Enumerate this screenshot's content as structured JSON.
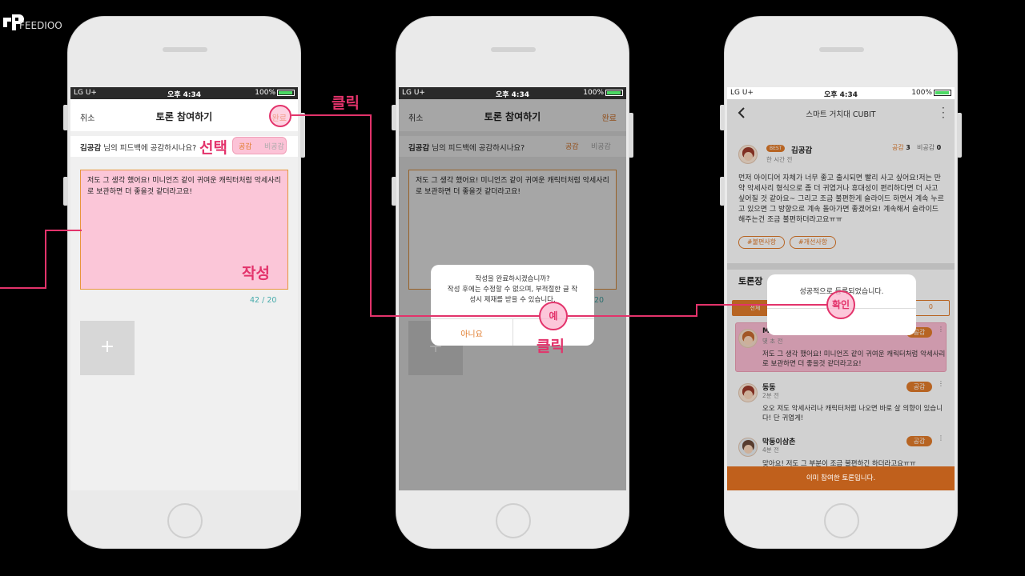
{
  "logo": {
    "text": "FEEDIOO"
  },
  "annotations": {
    "click1": "클릭",
    "select": "선택",
    "write": "작성",
    "click2": "클릭"
  },
  "status": {
    "carrier": "LG U+",
    "time": "오후 4:34",
    "battery": "100%"
  },
  "phone1": {
    "cancel": "취소",
    "title": "토론 참여하기",
    "done": "완료",
    "question_name": "김공감",
    "question_text": " 님의 피드백에 공감하시나요?",
    "agree": "공감",
    "disagree": "비공감",
    "body": "저도 그 생각 했어요! 미니언즈 같이 귀여운 캐릭터처럼 악세사리로 보관하면 더 좋을것 같더라고요!",
    "count": "42 / 20",
    "add": "+"
  },
  "phone2": {
    "cancel": "취소",
    "title": "토론 참여하기",
    "done": "완료",
    "question_name": "김공감",
    "question_text": " 님의 피드백에 공감하시나요?",
    "agree": "공감",
    "disagree": "비공감",
    "body": "저도 그 생각 했어요! 미니언즈 같이 귀여운 캐릭터처럼 악세사리로 보관하면 더 좋을것 같더라고요!",
    "count": "20",
    "add": "+",
    "dialog": {
      "line1": "작성을 완료하시겠습니까?",
      "line2": "작성 후에는 수정할 수 없으며, 부적절한 글 작",
      "line3": "성시 제재를 받을 수 있습니다.",
      "no": "아니요",
      "yes": "예"
    }
  },
  "phone3": {
    "nav_title": "스마트 거치대 CUBIT",
    "author": "김공감",
    "badge": "BEST",
    "time": "한 시간 전",
    "agree_label": "공감",
    "agree_count": "3",
    "disagree_label": "비공감",
    "disagree_count": "0",
    "post": "먼저 아이디어 자체가 너무 좋고 출시되면 빨리 사고 싶어요!저는 만약 악세사리 형식으로 좀 더 귀엽거나 휴대성이 편리하다면 더 사고 싶어질 것 같아요~ 그리고 조금 불편한게 슬라이드 하면서 계속 누르고 있으면 그 방향으로 계속 돌아가면 좋겠어요! 계속해서 슬라이드 해주는건 조금 불편하더라고요ㅠㅠ",
    "tags": [
      "#불편사항",
      "#개선사항"
    ],
    "section": "토론장",
    "tab_left": "전체",
    "tab_right": "0",
    "dialog": {
      "text": "성공적으로 등록되었습니다.",
      "ok": "확인"
    },
    "comments": [
      {
        "name": "Matt",
        "time": "몇 초 전",
        "pill": "공감",
        "text": "저도 그 생각 했어요! 미니언즈 같이 귀여운 캐릭터처럼 악세사리로 보관하면 더 좋을것 같더라고요!"
      },
      {
        "name": "동동",
        "time": "2분 전",
        "pill": "공감",
        "text": "오오 저도 악세사리나 캐릭터처럼 나오면 바로 살 의향이 있습니다! 단 귀엽게!"
      },
      {
        "name": "막둥이삼촌",
        "time": "4분 전",
        "pill": "공감",
        "text": "맞아요! 저도 그 부분이 조금 불편하긴 하더라고요ㅠㅠ"
      }
    ],
    "footer": "이미 참여한 토론입니다."
  }
}
